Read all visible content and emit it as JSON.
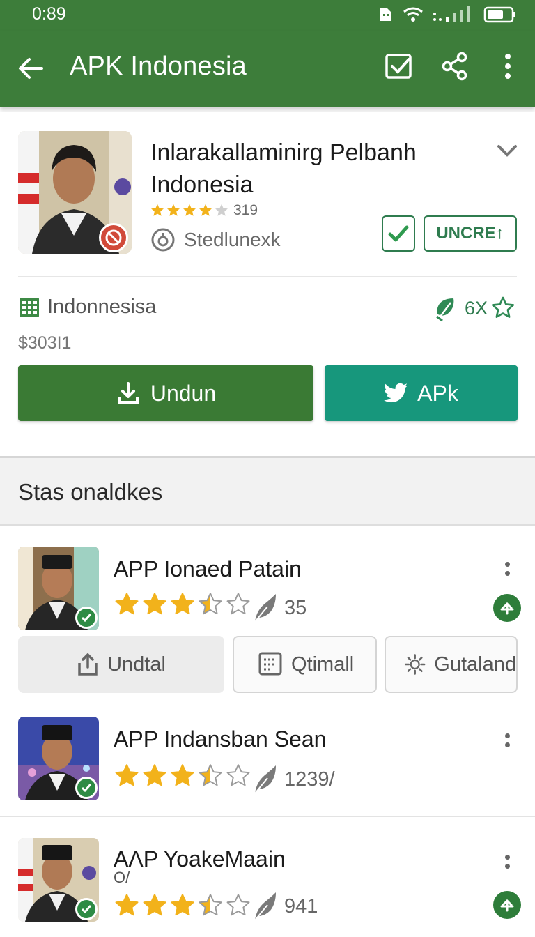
{
  "status_bar": {
    "time": "0:89"
  },
  "app_bar": {
    "title": "APK Indonesia"
  },
  "hero": {
    "title": "Inlarakallaminirg Pelbanh Indonesia",
    "rating": 4,
    "rating_count": "319",
    "developer": "Stedlunexk",
    "action_label": "UNCRE↑",
    "category": "Indonnesisa",
    "reward": "6X",
    "price": "$303I1",
    "primary_button": "Undun",
    "secondary_button": "APk"
  },
  "section": {
    "title": "Stas onaldkes"
  },
  "list": [
    {
      "title": "APP Ionaed Patain",
      "rating": 3.5,
      "downloads": "35",
      "chips": [
        "Undtal",
        "Qtimall",
        "Gutaland"
      ]
    },
    {
      "title": "APP Indansban Sean",
      "rating": 3.5,
      "downloads": "1239/"
    },
    {
      "title": "AɅP YoakeMaain",
      "subtitle": "O/",
      "rating": 3.5,
      "downloads": "941"
    }
  ],
  "colors": {
    "primary_green": "#3d7d3a",
    "teal": "#17977c",
    "star": "#f2b21b",
    "check_green": "#2e8b45"
  }
}
